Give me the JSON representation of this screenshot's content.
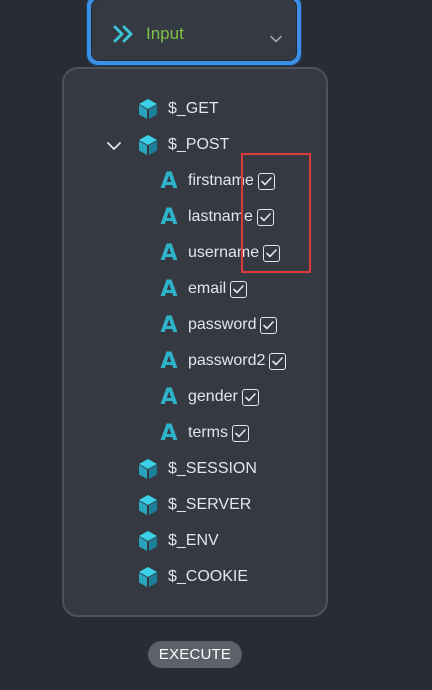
{
  "input_node": {
    "label": "Input",
    "icon": "double-chevron-right-icon",
    "accent_color": "#3d8ee6",
    "label_color": "#7fc24a"
  },
  "variables": [
    {
      "name": "$_GET",
      "icon": "cube-icon"
    },
    {
      "name": "$_POST",
      "icon": "cube-icon",
      "expanded": true
    },
    {
      "name": "$_SESSION",
      "icon": "cube-icon"
    },
    {
      "name": "$_SERVER",
      "icon": "cube-icon"
    },
    {
      "name": "$_ENV",
      "icon": "cube-icon"
    },
    {
      "name": "$_COOKIE",
      "icon": "cube-icon"
    }
  ],
  "post_fields": [
    {
      "name": "firstname",
      "checked": true
    },
    {
      "name": "lastname",
      "checked": true
    },
    {
      "name": "username",
      "checked": true
    },
    {
      "name": "email",
      "checked": true
    },
    {
      "name": "password",
      "checked": true
    },
    {
      "name": "password2",
      "checked": true
    },
    {
      "name": "gender",
      "checked": true
    },
    {
      "name": "terms",
      "checked": true
    }
  ],
  "field_icon_glyph": "A",
  "field_icon_color": "#2fb3c9",
  "highlight_color": "#e0393b",
  "execute_label": "EXECUTE"
}
